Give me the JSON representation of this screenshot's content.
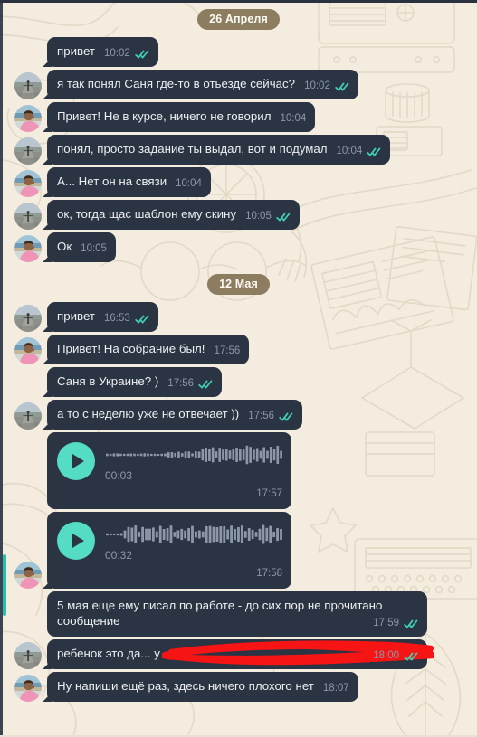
{
  "app": {
    "name": "Telegram",
    "view": "chat-conversation",
    "background_color": "#f3ecdf",
    "bubble_color": "#2b3442",
    "text_color": "#eceff3",
    "time_color": "#8d98a6",
    "tick_color": "#3fd0b5",
    "date_badge_color": "#8c7c60",
    "accent_color": "#54dcc4",
    "redaction_color": "#f71414",
    "scrollbar_color": "#29bfb0"
  },
  "dates": {
    "first": "26 Апреля",
    "second": "12 Мая"
  },
  "avatars": {
    "road": "avatar-person-on-road",
    "pink": "avatar-person-in-pink-shirt"
  },
  "icons": {
    "play": "play-icon",
    "double_check": "double-check-icon"
  },
  "messages": [
    {
      "id": "m1",
      "sender": "road",
      "avatar": false,
      "tail": true,
      "text": "привет",
      "time": "10:02",
      "ticks": true,
      "type": "text"
    },
    {
      "id": "m2",
      "sender": "road",
      "avatar": true,
      "tail": true,
      "text": "я так понял Саня где-то в отьезде сейчас?",
      "time": "10:02",
      "ticks": true,
      "type": "text"
    },
    {
      "id": "m3",
      "sender": "pink",
      "avatar": true,
      "tail": true,
      "text": "Привет! Не в курсе, ничего не говорил",
      "time": "10:04",
      "ticks": false,
      "type": "text"
    },
    {
      "id": "m4",
      "sender": "road",
      "avatar": true,
      "tail": true,
      "text": "понял, просто задание ты выдал, вот и подумал",
      "time": "10:04",
      "ticks": true,
      "type": "text"
    },
    {
      "id": "m5",
      "sender": "pink",
      "avatar": true,
      "tail": true,
      "text": "А... Нет он на связи",
      "time": "10:04",
      "ticks": false,
      "type": "text"
    },
    {
      "id": "m6",
      "sender": "road",
      "avatar": true,
      "tail": true,
      "text": "ок, тогда щас шаблон ему скину",
      "time": "10:05",
      "ticks": true,
      "type": "text"
    },
    {
      "id": "m7",
      "sender": "pink",
      "avatar": true,
      "tail": true,
      "text": "Ок",
      "time": "10:05",
      "ticks": false,
      "type": "text"
    },
    {
      "id": "m8",
      "sender": "road",
      "avatar": true,
      "tail": true,
      "text": "привет",
      "time": "16:53",
      "ticks": true,
      "type": "text"
    },
    {
      "id": "m9",
      "sender": "pink",
      "avatar": true,
      "tail": true,
      "text": "Привет! На собрание был!",
      "time": "17:56",
      "ticks": false,
      "type": "text"
    },
    {
      "id": "m10",
      "sender": "road",
      "avatar": false,
      "tail": true,
      "text": "Саня в Украине? )",
      "time": "17:56",
      "ticks": true,
      "type": "text"
    },
    {
      "id": "m11",
      "sender": "road",
      "avatar": true,
      "tail": true,
      "text": "а то с неделю уже не отвечает ))",
      "time": "17:56",
      "ticks": true,
      "type": "text"
    },
    {
      "id": "m12",
      "sender": "pink",
      "avatar": false,
      "tail": false,
      "type": "voice",
      "duration": "00:03",
      "time": "17:57",
      "ticks": false
    },
    {
      "id": "m13",
      "sender": "pink",
      "avatar": true,
      "tail": true,
      "type": "voice",
      "duration": "00:32",
      "time": "17:58",
      "ticks": false
    },
    {
      "id": "m14",
      "sender": "road",
      "avatar": false,
      "tail": false,
      "text": "5 мая еще ему писал по работе - до сих пор не прочитано сообщение",
      "time": "17:59",
      "ticks": true,
      "type": "text-wrapped"
    },
    {
      "id": "m15",
      "sender": "road",
      "avatar": true,
      "tail": true,
      "text": "ребенок это да... у",
      "time": "18:00",
      "ticks": true,
      "type": "text-redacted",
      "redacted": true
    },
    {
      "id": "m16",
      "sender": "pink",
      "avatar": true,
      "tail": true,
      "text": "Ну напиши ещё раз, здесь ничего плохого нет",
      "time": "18:07",
      "ticks": false,
      "type": "text"
    }
  ]
}
